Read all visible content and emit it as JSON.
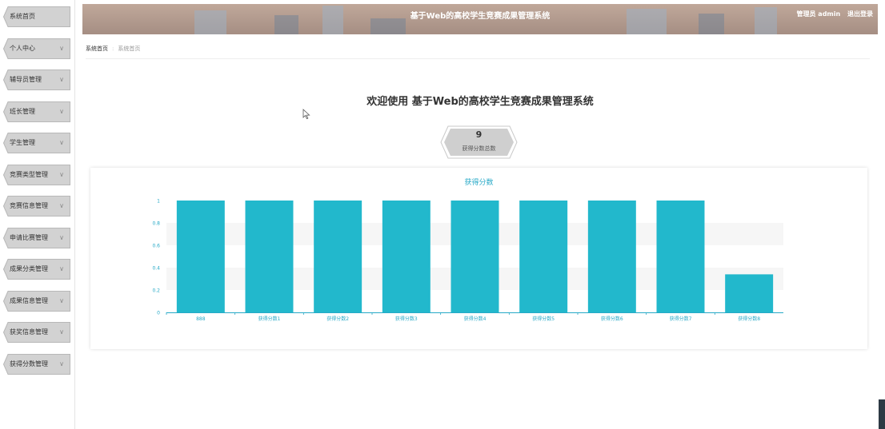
{
  "sidebar": {
    "items": [
      {
        "label": "系统首页",
        "chevron": ""
      },
      {
        "label": "个人中心",
        "chevron": "∨"
      },
      {
        "label": "辅导员管理",
        "chevron": "∨"
      },
      {
        "label": "班长管理",
        "chevron": "∨"
      },
      {
        "label": "学生管理",
        "chevron": "∨"
      },
      {
        "label": "竞赛类型管理",
        "chevron": "∨"
      },
      {
        "label": "竞赛信息管理",
        "chevron": "∨"
      },
      {
        "label": "申请比赛管理",
        "chevron": "∨"
      },
      {
        "label": "成果分类管理",
        "chevron": "∨"
      },
      {
        "label": "成果信息管理",
        "chevron": "∨"
      },
      {
        "label": "获奖信息管理",
        "chevron": "∨"
      },
      {
        "label": "获得分数管理",
        "chevron": "∨"
      }
    ]
  },
  "header": {
    "title": "基于Web的高校学生竞赛成果管理系统",
    "user": "管理员 admin",
    "logout": "退出登录"
  },
  "breadcrumb": {
    "home": "系统首页",
    "sep": ":",
    "current": "系统首页"
  },
  "welcome": "欢迎使用 基于Web的高校学生竞赛成果管理系统",
  "stat": {
    "value": "9",
    "label": "获得分数总数"
  },
  "colors": {
    "bar": "#22b8cc",
    "accent": "#27a9c7",
    "sidebar_tile": "#d2d2d2"
  },
  "chart_data": {
    "type": "bar",
    "title": "获得分数",
    "categories": [
      "888",
      "获得分数1",
      "获得分数2",
      "获得分数3",
      "获得分数4",
      "获得分数5",
      "获得分数6",
      "获得分数7",
      "获得分数8"
    ],
    "values": [
      1,
      1,
      1,
      1,
      1,
      1,
      1,
      1,
      0.34
    ],
    "yticks": [
      "0",
      "0.2",
      "0.4",
      "0.6",
      "0.8",
      "1"
    ],
    "ylim": [
      0,
      1
    ],
    "grid": "horizontal bands"
  }
}
